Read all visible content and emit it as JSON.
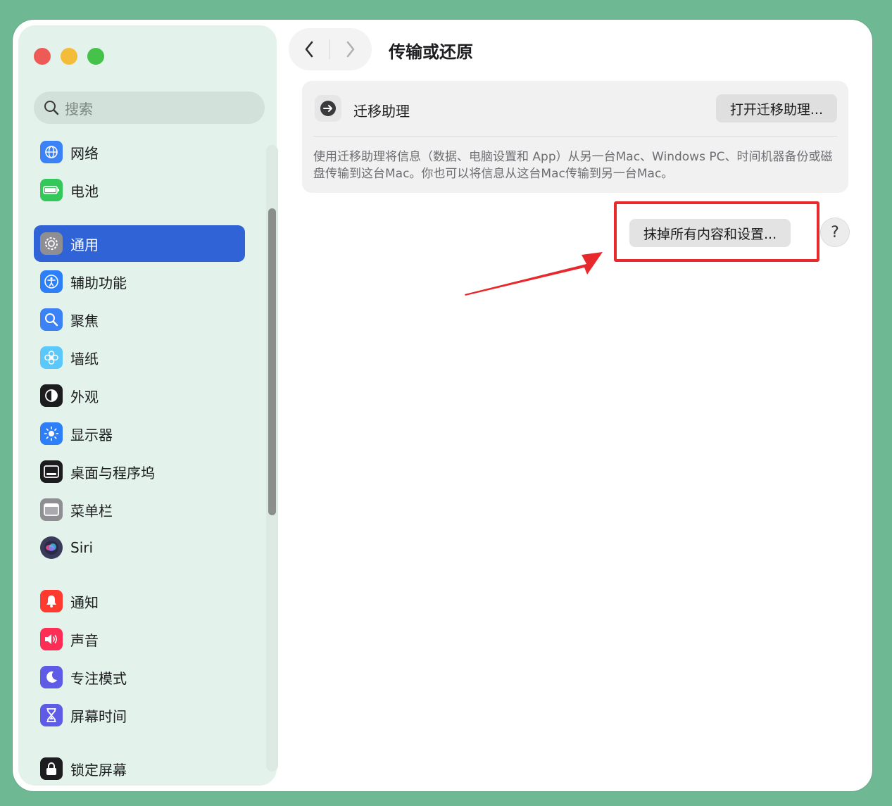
{
  "window": {
    "title": "传输或还原",
    "nav": {
      "back_icon": "chevron-left-icon",
      "forward_icon": "chevron-right-icon"
    }
  },
  "sidebar": {
    "search_placeholder": "搜索",
    "items": [
      {
        "label": "网络",
        "icon": "globe-icon",
        "color": "#3b82f6",
        "active": false
      },
      {
        "label": "电池",
        "icon": "battery-icon",
        "color": "#34c759",
        "active": false
      },
      {
        "label": "通用",
        "icon": "gear-icon",
        "color": "#8e8e93",
        "active": true
      },
      {
        "label": "辅助功能",
        "icon": "accessibility-icon",
        "color": "#2d7ff9",
        "active": false
      },
      {
        "label": "聚焦",
        "icon": "magnifier-icon",
        "color": "#3b82f6",
        "active": false
      },
      {
        "label": "墙纸",
        "icon": "flower-icon",
        "color": "#5ac8fa",
        "active": false
      },
      {
        "label": "外观",
        "icon": "appearance-icon",
        "color": "#1d1d1f",
        "active": false
      },
      {
        "label": "显示器",
        "icon": "sun-icon",
        "color": "#2d7ff9",
        "active": false
      },
      {
        "label": "桌面与程序坞",
        "icon": "dock-icon",
        "color": "#1d1d1f",
        "active": false
      },
      {
        "label": "菜单栏",
        "icon": "menubar-icon",
        "color": "#8e8e93",
        "active": false
      },
      {
        "label": "Siri",
        "icon": "siri-icon",
        "color": "#3a3a5a",
        "active": false
      },
      {
        "label": "通知",
        "icon": "bell-icon",
        "color": "#ff3b30",
        "active": false
      },
      {
        "label": "声音",
        "icon": "speaker-icon",
        "color": "#ff2d55",
        "active": false
      },
      {
        "label": "专注模式",
        "icon": "moon-icon",
        "color": "#5e5ce6",
        "active": false
      },
      {
        "label": "屏幕时间",
        "icon": "hourglass-icon",
        "color": "#5e5ce6",
        "active": false
      },
      {
        "label": "锁定屏幕",
        "icon": "lock-icon",
        "color": "#1d1d1f",
        "active": false
      }
    ]
  },
  "main": {
    "migration": {
      "title": "迁移助理",
      "button": "打开迁移助理...",
      "description": "使用迁移助理将信息（数据、电脑设置和 App）从另一台Mac、Windows PC、时间机器备份或磁盘传输到这台Mac。你也可以将信息从这台Mac传输到另一台Mac。"
    },
    "erase_button": "抹掉所有内容和设置...",
    "help_label": "?"
  },
  "annotation": {
    "highlight_color": "#e8292c"
  }
}
